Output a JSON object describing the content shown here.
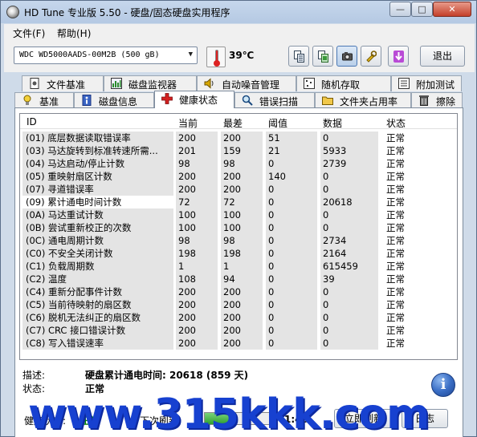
{
  "window": {
    "title": "HD Tune 专业版 5.50 - 硬盘/固态硬盘实用程序",
    "min_glyph": "—",
    "max_glyph": "□",
    "close_glyph": "✕"
  },
  "menu": {
    "items": [
      "文件(F)",
      "帮助(H)"
    ]
  },
  "toolbar": {
    "drive": "WDC WD5000AADS-00M2B (500 gB)",
    "temperature": "39℃",
    "icons": [
      "copy-text-icon",
      "copy-screen-icon",
      "screenshot-camera-icon",
      "options-tools-icon",
      "save-download-icon"
    ],
    "exit_label": "退出"
  },
  "tabs_top": [
    {
      "label": "文件基准",
      "icon": "file-benchmark-icon"
    },
    {
      "label": "磁盘监视器",
      "icon": "disk-monitor-icon"
    },
    {
      "label": "自动噪音管理",
      "icon": "speaker-icon"
    },
    {
      "label": "随机存取",
      "icon": "random-access-icon"
    },
    {
      "label": "附加测试",
      "icon": "extra-tests-icon"
    }
  ],
  "tabs_bottom": [
    {
      "label": "基准",
      "icon": "benchmark-icon"
    },
    {
      "label": "磁盘信息",
      "icon": "disk-info-icon"
    },
    {
      "label": "健康状态",
      "icon": "health-cross-icon",
      "active": true
    },
    {
      "label": "错误扫描",
      "icon": "error-scan-icon"
    },
    {
      "label": "文件夹占用率",
      "icon": "folder-usage-icon"
    },
    {
      "label": "擦除",
      "icon": "erase-trash-icon"
    }
  ],
  "grid": {
    "headers": {
      "id": "ID",
      "current": "当前",
      "worst": "最差",
      "threshold": "阈值",
      "data": "数据",
      "status": "状态"
    },
    "rows": [
      {
        "id": "(01) 底层数据读取错误率",
        "current": "200",
        "worst": "200",
        "threshold": "51",
        "data": "0",
        "status": "正常"
      },
      {
        "id": "(03) 马达旋转到标准转速所需...",
        "current": "201",
        "worst": "159",
        "threshold": "21",
        "data": "5933",
        "status": "正常"
      },
      {
        "id": "(04) 马达启动/停止计数",
        "current": "98",
        "worst": "98",
        "threshold": "0",
        "data": "2739",
        "status": "正常"
      },
      {
        "id": "(05) 重映射扇区计数",
        "current": "200",
        "worst": "200",
        "threshold": "140",
        "data": "0",
        "status": "正常"
      },
      {
        "id": "(07) 寻道错误率",
        "current": "200",
        "worst": "200",
        "threshold": "0",
        "data": "0",
        "status": "正常"
      },
      {
        "id": "(09) 累计通电时间计数",
        "current": "72",
        "worst": "72",
        "threshold": "0",
        "data": "20618",
        "status": "正常",
        "selected": true
      },
      {
        "id": "(0A) 马达重试计数",
        "current": "100",
        "worst": "100",
        "threshold": "0",
        "data": "0",
        "status": "正常"
      },
      {
        "id": "(0B) 尝试重新校正的次数",
        "current": "100",
        "worst": "100",
        "threshold": "0",
        "data": "0",
        "status": "正常"
      },
      {
        "id": "(0C) 通电周期计数",
        "current": "98",
        "worst": "98",
        "threshold": "0",
        "data": "2734",
        "status": "正常"
      },
      {
        "id": "(C0) 不安全关闭计数",
        "current": "198",
        "worst": "198",
        "threshold": "0",
        "data": "2164",
        "status": "正常"
      },
      {
        "id": "(C1) 负载周期数",
        "current": "1",
        "worst": "1",
        "threshold": "0",
        "data": "615459",
        "status": "正常"
      },
      {
        "id": "(C2) 温度",
        "current": "108",
        "worst": "94",
        "threshold": "0",
        "data": "39",
        "status": "正常"
      },
      {
        "id": "(C4) 重新分配事件计数",
        "current": "200",
        "worst": "200",
        "threshold": "0",
        "data": "0",
        "status": "正常"
      },
      {
        "id": "(C5) 当前待映射的扇区数",
        "current": "200",
        "worst": "200",
        "threshold": "0",
        "data": "0",
        "status": "正常"
      },
      {
        "id": "(C6) 脱机无法纠正的扇区数",
        "current": "200",
        "worst": "200",
        "threshold": "0",
        "data": "0",
        "status": "正常"
      },
      {
        "id": "(C7) CRC 接口错误计数",
        "current": "200",
        "worst": "200",
        "threshold": "0",
        "data": "0",
        "status": "正常"
      },
      {
        "id": "(C8) 写入错误速率",
        "current": "200",
        "worst": "200",
        "threshold": "0",
        "data": "0",
        "status": "正常"
      }
    ]
  },
  "details": {
    "desc_label": "描述:",
    "desc_value": "硬盘累计通电时间: 20618 (859 天)",
    "status_label": "状态:",
    "status_value": "正常",
    "info_glyph": "i"
  },
  "bottom": {
    "health_label": "健康状态:",
    "health_value": "正常",
    "next_refresh_label": "下次刷新:",
    "countdown": "1:46",
    "refresh_progress": 0.45,
    "refresh_now_label": "立即刷新",
    "log_label": "日志"
  },
  "watermark": "www.315kkk.com",
  "colors": {
    "accent": "#1741d0",
    "window_frame": "#cfdbe9",
    "ok_green": "#008000"
  }
}
